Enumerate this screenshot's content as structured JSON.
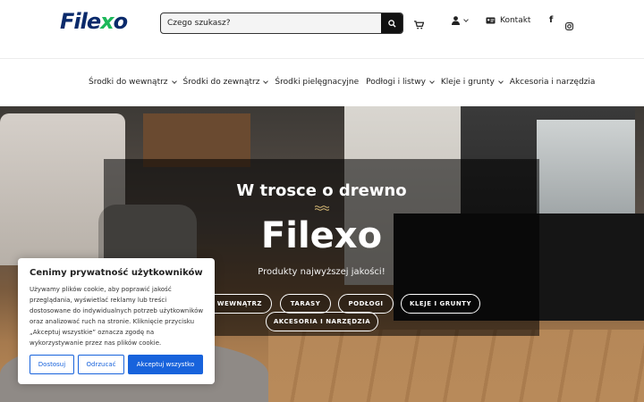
{
  "header": {
    "logo_prefix": "File",
    "logo_x": "x",
    "logo_suffix": "o",
    "search_placeholder": "Czego szukasz?",
    "contact_label": "Kontakt",
    "icons": [
      "search-icon",
      "cart-icon",
      "user-icon",
      "chevron-down-icon",
      "contact-card-icon",
      "facebook-icon",
      "instagram-icon"
    ]
  },
  "nav": {
    "items": [
      {
        "label": "Środki do wewnątrz",
        "dropdown": true
      },
      {
        "label": "Środki do zewnątrz",
        "dropdown": true
      },
      {
        "label": "Środki pielęgnacyjne",
        "dropdown": false
      },
      {
        "label": "Podłogi i listwy",
        "dropdown": true
      },
      {
        "label": "Kleje i grunty",
        "dropdown": true
      },
      {
        "label": "Akcesoria i narzędzia",
        "dropdown": false
      }
    ]
  },
  "hero": {
    "subtitle": "W trosce o drewno",
    "title": "Filexo",
    "tagline": "Produkty najwyższej jakości!",
    "buttons": [
      "DO WEWNĄTRZ",
      "TARASY",
      "PODŁOGI",
      "KLEJE I GRUNTY",
      "AKCESORIA I NARZĘDZIA"
    ]
  },
  "cookie": {
    "title": "Cenimy prywatność użytkowników",
    "text": "Używamy plików cookie, aby poprawić jakość przeglądania, wyświetlać reklamy lub treści dostosowane do indywidualnych potrzeb użytkowników oraz analizować ruch na stronie. Kliknięcie przycisku „Akceptuj wszystkie” oznacza zgodę na wykorzystywanie przez nas plików cookie.",
    "customize": "Dostosuj",
    "reject": "Odrzucać",
    "accept": "Akceptuj wszystko",
    "accent_color": "#1863dc"
  }
}
